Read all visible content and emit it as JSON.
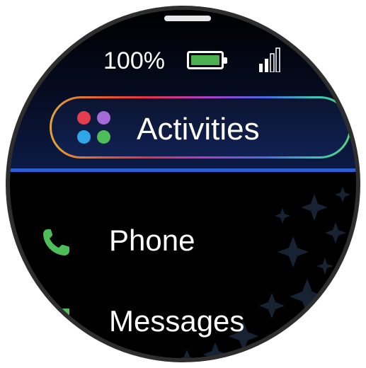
{
  "status": {
    "battery_percent_label": "100%",
    "battery_level": 1.0
  },
  "activities_button": {
    "label": "Activities"
  },
  "menu": {
    "items": [
      {
        "label": "Phone",
        "icon": "phone-icon"
      },
      {
        "label": "Messages",
        "icon": "message-icon"
      }
    ]
  },
  "colors": {
    "accent_blue": "#2a5fd3",
    "battery_green": "#4caf50",
    "phone_green": "#4fbe58"
  }
}
